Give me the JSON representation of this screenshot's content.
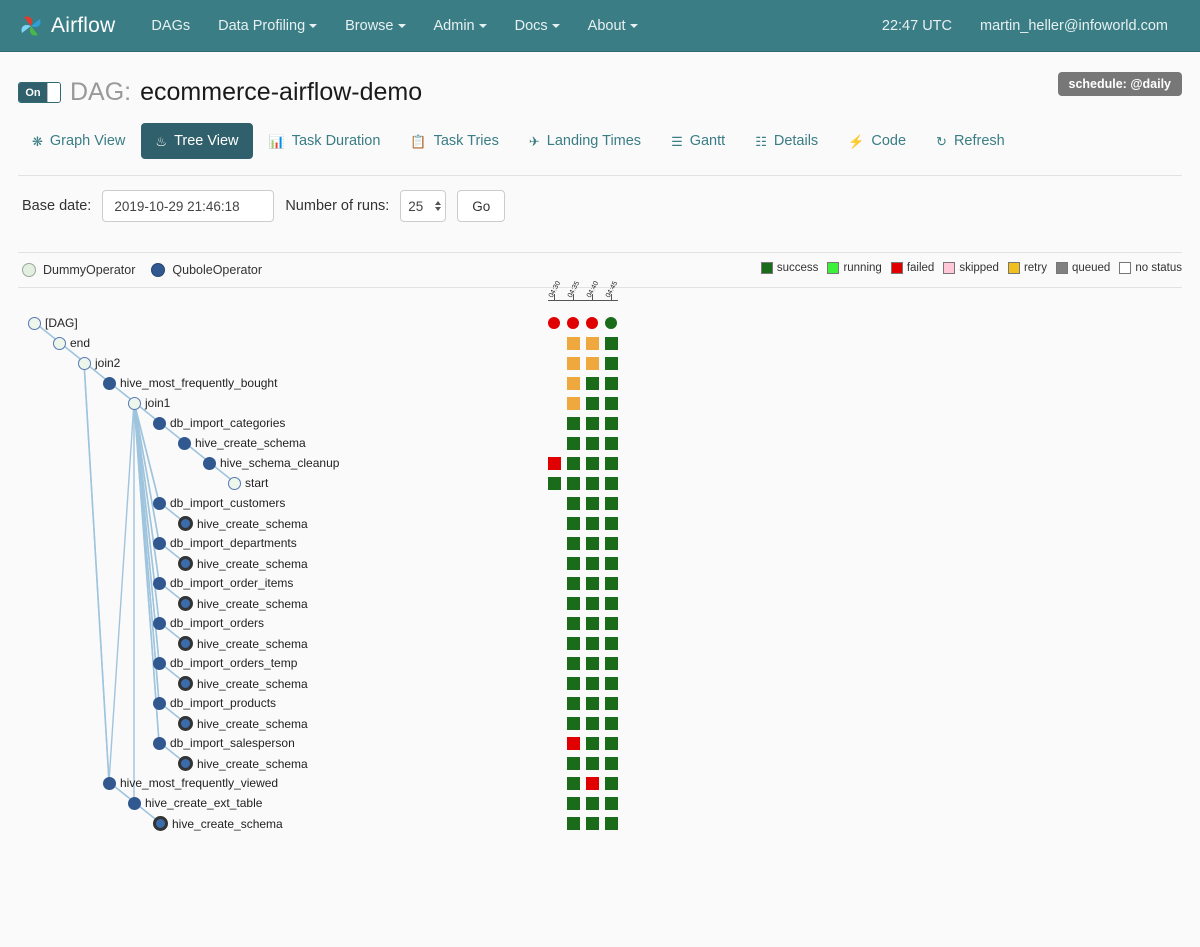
{
  "navbar": {
    "brand": "Airflow",
    "links": [
      {
        "label": "DAGs",
        "caret": false
      },
      {
        "label": "Data Profiling",
        "caret": true
      },
      {
        "label": "Browse",
        "caret": true
      },
      {
        "label": "Admin",
        "caret": true
      },
      {
        "label": "Docs",
        "caret": true
      },
      {
        "label": "About",
        "caret": true
      }
    ],
    "clock": "22:47 UTC",
    "user": "martin_heller@infoworld.com"
  },
  "header": {
    "toggle_state": "On",
    "dag_label": "DAG:",
    "dag_name": "ecommerce-airflow-demo",
    "schedule_badge": "schedule: @daily"
  },
  "tabs": [
    {
      "label": "Graph View",
      "icon": "asterisk-icon",
      "active": false
    },
    {
      "label": "Tree View",
      "icon": "tree-icon",
      "active": true
    },
    {
      "label": "Task Duration",
      "icon": "bar-chart-icon",
      "active": false
    },
    {
      "label": "Task Tries",
      "icon": "copy-icon",
      "active": false
    },
    {
      "label": "Landing Times",
      "icon": "plane-icon",
      "active": false
    },
    {
      "label": "Gantt",
      "icon": "align-left-icon",
      "active": false
    },
    {
      "label": "Details",
      "icon": "list-icon",
      "active": false
    },
    {
      "label": "Code",
      "icon": "bolt-icon",
      "active": false
    },
    {
      "label": "Refresh",
      "icon": "refresh-icon",
      "active": false
    }
  ],
  "form": {
    "base_date_label": "Base date:",
    "base_date_value": "2019-10-29 21:46:18",
    "base_date_placeholder": "",
    "num_runs_label": "Number of runs:",
    "num_runs_value": "25",
    "go_label": "Go"
  },
  "operator_legend": [
    {
      "label": "DummyOperator",
      "style": "dummy"
    },
    {
      "label": "QuboleOperator",
      "style": "qubole"
    }
  ],
  "status_legend": [
    {
      "label": "success",
      "color": "#1a6b1a"
    },
    {
      "label": "running",
      "color": "#3cf03c"
    },
    {
      "label": "failed",
      "color": "#e00000"
    },
    {
      "label": "skipped",
      "color": "#ffc8d8"
    },
    {
      "label": "retry",
      "color": "#efc01e"
    },
    {
      "label": "queued",
      "color": "#808080"
    },
    {
      "label": "no status",
      "color": "#ffffff"
    }
  ],
  "grid": {
    "date_labels": [
      "04:30",
      "04:35",
      "04:40",
      "04:45"
    ],
    "colors": {
      "success": "#1a6b1a",
      "running": "#3cf03c",
      "failed": "#e00000",
      "skipped": "#ffc8d8",
      "retry": "#efa83e",
      "queued": "#808080",
      "none": "#ffffff"
    }
  },
  "tree": {
    "nodes": [
      {
        "label": "[DAG]",
        "depth": 0,
        "kind": "dummy",
        "row": 0,
        "cells": [],
        "circles": [
          "failed",
          "failed",
          "failed",
          "success"
        ]
      },
      {
        "label": "end",
        "depth": 1,
        "kind": "dummy",
        "row": 1,
        "cells": [
          "none",
          "retry",
          "retry",
          "success"
        ],
        "circles": []
      },
      {
        "label": "join2",
        "depth": 2,
        "kind": "dummy",
        "row": 2,
        "cells": [
          "none",
          "retry",
          "retry",
          "success"
        ],
        "circles": []
      },
      {
        "label": "hive_most_frequently_bought",
        "depth": 3,
        "kind": "qubole",
        "row": 3,
        "cells": [
          "none",
          "retry",
          "success",
          "success"
        ],
        "circles": []
      },
      {
        "label": "join1",
        "depth": 4,
        "kind": "dummy",
        "row": 4,
        "cells": [
          "none",
          "retry",
          "success",
          "success"
        ],
        "circles": []
      },
      {
        "label": "db_import_categories",
        "depth": 5,
        "kind": "qubole",
        "row": 5,
        "cells": [
          "none",
          "success",
          "success",
          "success"
        ],
        "circles": []
      },
      {
        "label": "hive_create_schema",
        "depth": 6,
        "kind": "qubole",
        "row": 6,
        "cells": [
          "none",
          "success",
          "success",
          "success"
        ],
        "circles": []
      },
      {
        "label": "hive_schema_cleanup",
        "depth": 7,
        "kind": "qubole",
        "row": 7,
        "cells": [
          "failed",
          "success",
          "success",
          "success"
        ],
        "circles": []
      },
      {
        "label": "start",
        "depth": 8,
        "kind": "dummy",
        "row": 8,
        "cells": [
          "success",
          "success",
          "success",
          "success"
        ],
        "circles": []
      },
      {
        "label": "db_import_customers",
        "depth": 5,
        "kind": "qubole",
        "row": 9,
        "cells": [
          "none",
          "success",
          "success",
          "success"
        ],
        "circles": []
      },
      {
        "label": "hive_create_schema",
        "depth": 6,
        "kind": "qubole-collapsed",
        "row": 10,
        "cells": [
          "none",
          "success",
          "success",
          "success"
        ],
        "circles": []
      },
      {
        "label": "db_import_departments",
        "depth": 5,
        "kind": "qubole",
        "row": 11,
        "cells": [
          "none",
          "success",
          "success",
          "success"
        ],
        "circles": []
      },
      {
        "label": "hive_create_schema",
        "depth": 6,
        "kind": "qubole-collapsed",
        "row": 12,
        "cells": [
          "none",
          "success",
          "success",
          "success"
        ],
        "circles": []
      },
      {
        "label": "db_import_order_items",
        "depth": 5,
        "kind": "qubole",
        "row": 13,
        "cells": [
          "none",
          "success",
          "success",
          "success"
        ],
        "circles": []
      },
      {
        "label": "hive_create_schema",
        "depth": 6,
        "kind": "qubole-collapsed",
        "row": 14,
        "cells": [
          "none",
          "success",
          "success",
          "success"
        ],
        "circles": []
      },
      {
        "label": "db_import_orders",
        "depth": 5,
        "kind": "qubole",
        "row": 15,
        "cells": [
          "none",
          "success",
          "success",
          "success"
        ],
        "circles": []
      },
      {
        "label": "hive_create_schema",
        "depth": 6,
        "kind": "qubole-collapsed",
        "row": 16,
        "cells": [
          "none",
          "success",
          "success",
          "success"
        ],
        "circles": []
      },
      {
        "label": "db_import_orders_temp",
        "depth": 5,
        "kind": "qubole",
        "row": 17,
        "cells": [
          "none",
          "success",
          "success",
          "success"
        ],
        "circles": []
      },
      {
        "label": "hive_create_schema",
        "depth": 6,
        "kind": "qubole-collapsed",
        "row": 18,
        "cells": [
          "none",
          "success",
          "success",
          "success"
        ],
        "circles": []
      },
      {
        "label": "db_import_products",
        "depth": 5,
        "kind": "qubole",
        "row": 19,
        "cells": [
          "none",
          "success",
          "success",
          "success"
        ],
        "circles": []
      },
      {
        "label": "hive_create_schema",
        "depth": 6,
        "kind": "qubole-collapsed",
        "row": 20,
        "cells": [
          "none",
          "success",
          "success",
          "success"
        ],
        "circles": []
      },
      {
        "label": "db_import_salesperson",
        "depth": 5,
        "kind": "qubole",
        "row": 21,
        "cells": [
          "none",
          "failed",
          "success",
          "success"
        ],
        "circles": []
      },
      {
        "label": "hive_create_schema",
        "depth": 6,
        "kind": "qubole-collapsed",
        "row": 22,
        "cells": [
          "none",
          "success",
          "success",
          "success"
        ],
        "circles": []
      },
      {
        "label": "hive_most_frequently_viewed",
        "depth": 3,
        "kind": "qubole",
        "row": 23,
        "cells": [
          "none",
          "success",
          "failed",
          "success"
        ],
        "circles": []
      },
      {
        "label": "hive_create_ext_table",
        "depth": 4,
        "kind": "qubole",
        "row": 24,
        "cells": [
          "none",
          "success",
          "success",
          "success"
        ],
        "circles": []
      },
      {
        "label": "hive_create_schema",
        "depth": 5,
        "kind": "qubole-collapsed",
        "row": 25,
        "cells": [
          "none",
          "success",
          "success",
          "success"
        ],
        "circles": []
      }
    ]
  }
}
